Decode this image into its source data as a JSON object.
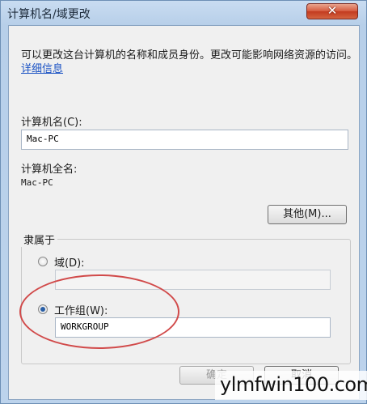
{
  "window": {
    "title": "计算机名/域更改",
    "close_symbol": "✕"
  },
  "description": {
    "text": "可以更改这台计算机的名称和成员身份。更改可能影响网络资源的访问。",
    "link": "详细信息"
  },
  "computer_name": {
    "label": "计算机名(C):",
    "value": "Mac-PC"
  },
  "full_name": {
    "label": "计算机全名:",
    "value": "Mac-PC"
  },
  "more_button": "其他(M)...",
  "member_of": {
    "title": "隶属于",
    "domain_label": "域(D):",
    "domain_value": "",
    "workgroup_label": "工作组(W):",
    "workgroup_value": "WORKGROUP",
    "selected": "workgroup"
  },
  "buttons": {
    "ok": "确定",
    "cancel": "取消"
  },
  "watermark": "ylmfwin100.com",
  "colors": {
    "annotation_ring": "#d14a4a",
    "link": "#1a52c4",
    "close_button": "#c23a1f"
  }
}
